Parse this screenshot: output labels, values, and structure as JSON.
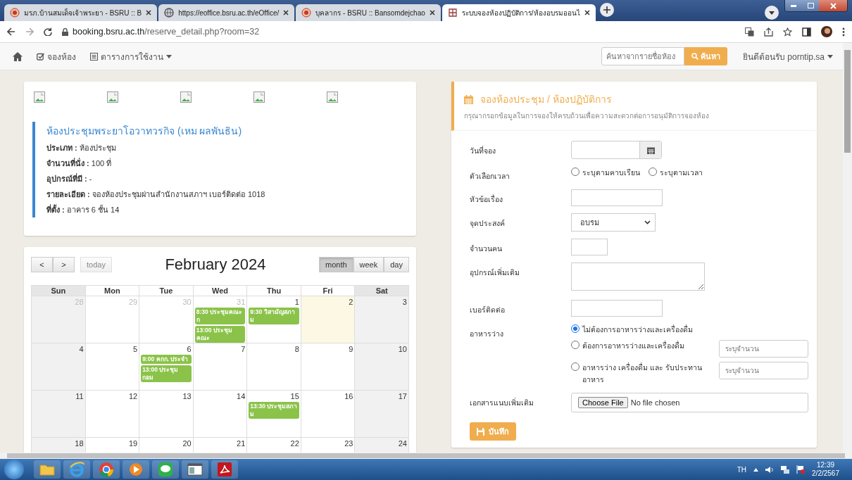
{
  "browser": {
    "tabs": [
      {
        "kind": "seal",
        "title": "มรภ.บ้านสมเด็จเจ้าพระยา - BSRU :: B",
        "selected": false
      },
      {
        "kind": "globe",
        "title": "https://eoffice.bsru.ac.th/eOffice/",
        "selected": false
      },
      {
        "kind": "seal",
        "title": "บุคลากร - BSRU :: Bansomdejchao",
        "selected": false
      },
      {
        "kind": "grid",
        "title": "ระบบจองห้องปฏิบัติการ/ห้องอบรมออนไ",
        "selected": true
      }
    ],
    "address": {
      "domain": "booking.bsru.ac.th",
      "path": "/reserve_detail.php?room=32"
    }
  },
  "navbar": {
    "items": [
      {
        "kind": "home"
      },
      {
        "kind": "check-link",
        "label": "จองห้อง"
      },
      {
        "kind": "list-menu",
        "label": "ตารางการใช้งาน"
      }
    ],
    "search": {
      "placeholder": "ค้นหาจากรายชื่อห้อง",
      "button": "ค้นหา"
    },
    "user": "ยินดีต้อนรับ porntip.sa"
  },
  "room": {
    "images": [
      {
        "kind": "broken"
      },
      {
        "kind": "broken"
      },
      {
        "kind": "broken"
      },
      {
        "kind": "broken"
      },
      {
        "kind": "broken"
      }
    ],
    "title": "ห้องประชุมพระยาโอวาทวรกิจ (เหม ผลพันธิน)",
    "details": [
      "**ประเภท :** ห้องประชุม",
      "**จำนวนที่นั่ง :** 100 ที่",
      "**อุปกรณ์ที่มี :** -",
      "**รายละเอียด :** จองห้องประชุมผ่านสำนักงานสภาฯ เบอร์ติดต่อ 1018",
      "**ที่ตั้ง :** อาคาร 6 ชั้น 14"
    ]
  },
  "calendar": {
    "title": "February 2024",
    "prev": "<",
    "next": ">",
    "today_button": {
      "label": "today",
      "disabled": true
    },
    "views": [
      {
        "label": "month",
        "selected": true
      },
      {
        "label": "week",
        "selected": false
      },
      {
        "label": "day",
        "selected": false
      }
    ],
    "weekdays": [
      {
        "label": "Sun",
        "weekend": true
      },
      {
        "label": "Mon",
        "weekend": false
      },
      {
        "label": "Tue",
        "weekend": false
      },
      {
        "label": "Wed",
        "weekend": false
      },
      {
        "label": "Thu",
        "weekend": false
      },
      {
        "label": "Fri",
        "weekend": false
      },
      {
        "label": "Sat",
        "weekend": true
      }
    ],
    "weeks": [
      [
        {
          "day": "28",
          "other_month": true,
          "today": false
        },
        {
          "day": "29",
          "other_month": true,
          "today": false
        },
        {
          "day": "30",
          "other_month": true,
          "today": false
        },
        {
          "day": "31",
          "other_month": true,
          "today": false,
          "events": [
            {
              "label": "8:30 ประชุมคณะก"
            },
            {
              "label": "13:00 ประชุมคณะ"
            }
          ]
        },
        {
          "day": "1",
          "other_month": false,
          "today": false,
          "events": [
            {
              "label": "9:30 วิสามัญสภาม"
            }
          ]
        },
        {
          "day": "2",
          "other_month": false,
          "today": true
        },
        {
          "day": "3",
          "other_month": false,
          "today": false
        }
      ],
      [
        {
          "day": "4",
          "other_month": false,
          "today": false
        },
        {
          "day": "5",
          "other_month": false,
          "today": false
        },
        {
          "day": "6",
          "other_month": false,
          "today": false,
          "events": [
            {
              "label": "9:00 คกก. ประจำ"
            },
            {
              "label": "13:00 ประชุม กอม"
            }
          ]
        },
        {
          "day": "7",
          "other_month": false,
          "today": false
        },
        {
          "day": "8",
          "other_month": false,
          "today": false
        },
        {
          "day": "9",
          "other_month": false,
          "today": false
        },
        {
          "day": "10",
          "other_month": false,
          "today": false
        }
      ],
      [
        {
          "day": "11",
          "other_month": false,
          "today": false
        },
        {
          "day": "12",
          "other_month": false,
          "today": false
        },
        {
          "day": "13",
          "other_month": false,
          "today": false
        },
        {
          "day": "14",
          "other_month": false,
          "today": false
        },
        {
          "day": "15",
          "other_month": false,
          "today": false,
          "events": [
            {
              "label": "13:30 ประชุมสภาม"
            }
          ]
        },
        {
          "day": "16",
          "other_month": false,
          "today": false
        },
        {
          "day": "17",
          "other_month": false,
          "today": false
        }
      ],
      [
        {
          "day": "18",
          "other_month": false,
          "today": false
        },
        {
          "day": "19",
          "other_month": false,
          "today": false
        },
        {
          "day": "20",
          "other_month": false,
          "today": false
        },
        {
          "day": "21",
          "other_month": false,
          "today": false
        },
        {
          "day": "22",
          "other_month": false,
          "today": false
        },
        {
          "day": "23",
          "other_month": false,
          "today": false
        },
        {
          "day": "24",
          "other_month": false,
          "today": false
        }
      ]
    ]
  },
  "form": {
    "title": "จองห้องประชุม / ห้องปฏิบัติการ",
    "subtitle": "กรุณากรอกข้อมูลในการจองให้ครบถ้วนเพื่อความสะดวกต่อการอนุมัติการจองห้อง",
    "fields": [
      {
        "kind": "date",
        "label": "วันที่จอง"
      },
      {
        "kind": "radios",
        "label": "ตัวเลือกเวลา",
        "options": [
          {
            "label": "ระบุตามคาบเรียน",
            "selected": false
          },
          {
            "label": "ระบุตามเวลา",
            "selected": false
          }
        ]
      },
      {
        "kind": "text",
        "label": "หัวข้อเรื่อง"
      },
      {
        "kind": "select",
        "label": "จุดประสงค์",
        "value": "อบรม"
      },
      {
        "kind": "short",
        "label": "จำนวนคน"
      },
      {
        "kind": "textarea",
        "label": "อุปกรณ์เพิ่มเติม"
      },
      {
        "kind": "text",
        "label": "เบอร์ติดต่อ"
      },
      {
        "kind": "snack",
        "label": "อาหารว่าง",
        "options": [
          {
            "label": "ไม่ต้องการอาหารว่างและเครื่องดื่ม",
            "selected": true
          },
          {
            "label": "ต้องการอาหารว่างและเครื่องดื่ม",
            "selected": false,
            "placeholder": "ระบุจำนวน"
          },
          {
            "label": "อาหารว่าง เครื่องดื่ม และ รับประทานอาหาร",
            "selected": false,
            "placeholder": "ระบุจำนวน"
          }
        ]
      },
      {
        "kind": "file",
        "label": "เอกสารแนบเพิ่มเติม",
        "button": "Choose File",
        "status": "No file chosen"
      }
    ],
    "submit": "บันทึก"
  },
  "taskbar": {
    "apps": [
      {
        "kind": "folder"
      },
      {
        "kind": "ie"
      },
      {
        "kind": "chrome"
      },
      {
        "kind": "media"
      },
      {
        "kind": "line"
      },
      {
        "kind": "window"
      },
      {
        "kind": "pdf"
      }
    ],
    "language": "TH",
    "time": "12:39",
    "date": "2/2/2567"
  }
}
